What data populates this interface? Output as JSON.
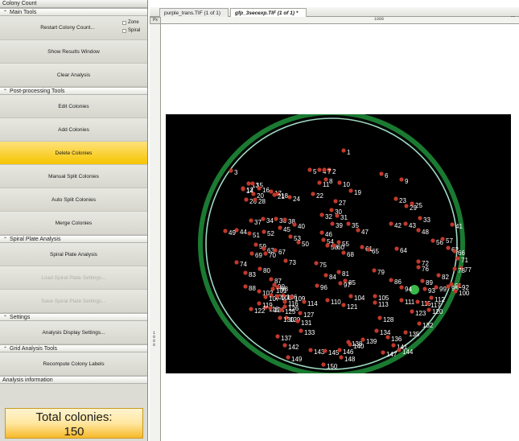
{
  "panel": {
    "title": "Colony Count",
    "main_tools": {
      "header": "Main Tools",
      "restart_label": "Restart Colony Count...",
      "options": [
        "Zone",
        "Spiral"
      ],
      "show_results": "Show Results Window",
      "clear_analysis": "Clear Analysis"
    },
    "post_processing": {
      "header": "Post-processing Tools",
      "buttons": [
        "Edit Colonies",
        "Add Colonies",
        "Delete Colonies",
        "Manual Split Colonies",
        "Auto Split Colonies",
        "Merge Colonies"
      ],
      "selected": "Delete Colonies"
    },
    "spiral_plate": {
      "header": "Spiral Plate Analysis",
      "analysis_button": "Spiral Plate Analysis",
      "disabled_buttons": [
        "Load Spiral Plate Settings...",
        "Save Spiral Plate Settings..."
      ]
    },
    "settings": {
      "header": "Settings",
      "display_button": "Analysis Display Settings..."
    },
    "grid": {
      "header": "Grid Analysis Tools",
      "recompute_button": "Recompute Colony Labels"
    },
    "info": {
      "header": "Analysis information",
      "total_label": "Total colonies:",
      "total_value": "150"
    }
  },
  "document": {
    "tabs": [
      "purple_trans.TIF (1 of 1) *",
      "gfp_3secexp.TIF (1 of 1) *"
    ],
    "active_tab": "gfp_3secexp.TIF (1 of 1) *",
    "close_label": "×",
    "ruler_corner": "Px",
    "ruler_top_label": "1000",
    "ruler_left_label": "1000"
  },
  "colors": {
    "selected_button": "#f5c400",
    "total_box": "#f7b829",
    "plate_circle": "#9fd9c0",
    "plate_rim": "#1f8f3a",
    "colony_marker": "#c0392b",
    "colony_label": "#ffffff"
  },
  "colonies": {
    "count": 150,
    "labels": [
      "1",
      "2",
      "3",
      "4",
      "5",
      "6",
      "7",
      "8",
      "9",
      "10",
      "11",
      "12",
      "13",
      "14",
      "15",
      "16",
      "17",
      "18",
      "19",
      "20",
      "21",
      "22",
      "23",
      "24",
      "25",
      "26",
      "27",
      "28",
      "29",
      "30",
      "31",
      "32",
      "33",
      "34",
      "35",
      "36",
      "37",
      "38",
      "39",
      "40",
      "41",
      "42",
      "43",
      "44",
      "45",
      "46",
      "47",
      "48",
      "49",
      "50",
      "51",
      "52",
      "53",
      "54",
      "55",
      "56",
      "57",
      "58",
      "59",
      "60",
      "61",
      "62",
      "63",
      "64",
      "65",
      "66",
      "67",
      "68",
      "69",
      "70",
      "71",
      "72",
      "73",
      "74",
      "75",
      "76",
      "77",
      "78",
      "79",
      "80",
      "81",
      "82",
      "83",
      "84",
      "85",
      "86",
      "87",
      "88",
      "89",
      "90",
      "91",
      "92",
      "93",
      "94",
      "95",
      "96",
      "97",
      "98",
      "99",
      "100",
      "101",
      "102",
      "103",
      "104",
      "105",
      "106",
      "107",
      "108",
      "109",
      "110",
      "111",
      "112",
      "113",
      "114",
      "115",
      "116",
      "117",
      "118",
      "119",
      "120",
      "121",
      "122",
      "123",
      "124",
      "125",
      "126",
      "127",
      "128",
      "129",
      "130",
      "131",
      "132",
      "133",
      "134",
      "135",
      "136",
      "137",
      "138",
      "139",
      "140",
      "141",
      "142",
      "143",
      "144",
      "145",
      "146",
      "147",
      "148",
      "149",
      "150"
    ]
  }
}
